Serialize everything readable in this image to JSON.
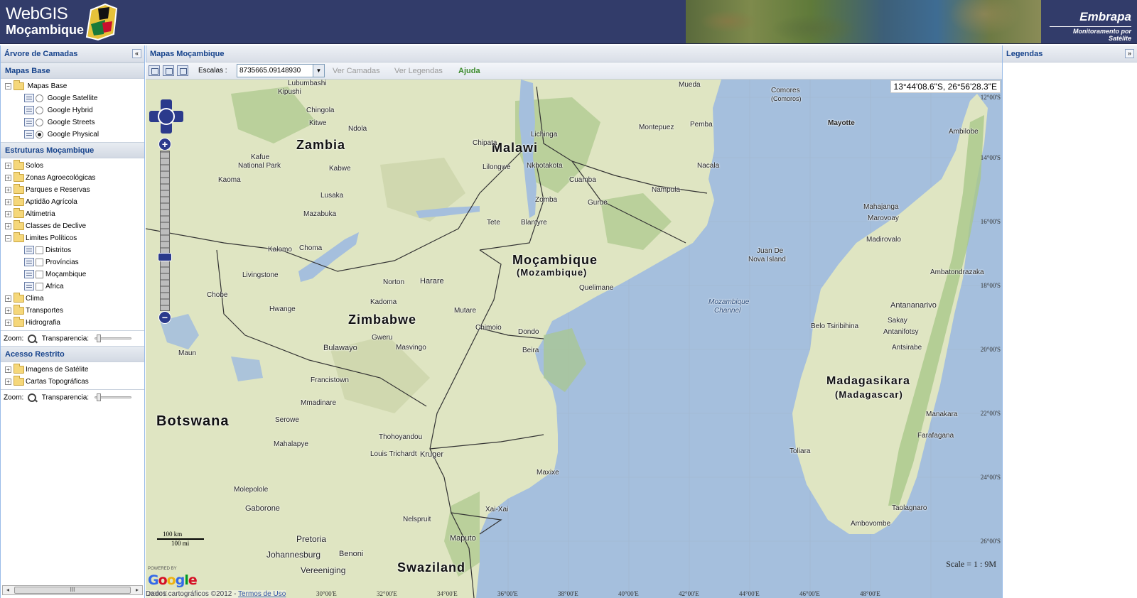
{
  "header": {
    "logo_line1": "WebGIS",
    "logo_line2": "Moçambique",
    "partner_name": "Embrapa",
    "partner_tagline": "Monitoramento por Satélite"
  },
  "left_panel": {
    "title": "Árvore de Camadas",
    "collapse_icon": "«",
    "sections": {
      "base": {
        "title": "Mapas Base",
        "folder": "Mapas Base",
        "layers": [
          "Google Satellite",
          "Google Hybrid",
          "Google Streets",
          "Google Physical"
        ],
        "selected": "Google Physical"
      },
      "estruturas": {
        "title": "Estruturas Moçambique",
        "folders": [
          "Solos",
          "Zonas Agroecológicas",
          "Parques e Reservas",
          "Aptidão Agrícola",
          "Altimetria",
          "Classes de Declive",
          "Limites Políticos"
        ],
        "limites_children": [
          "Distritos",
          "Províncias",
          "Moçambique",
          "Africa"
        ],
        "folders_after": [
          "Clima",
          "Transportes",
          "Hidrografia"
        ]
      },
      "acesso": {
        "title": "Acesso Restrito",
        "folders": [
          "Imagens de Satélite",
          "Cartas Topográficas"
        ]
      }
    },
    "zoom_label": "Zoom:",
    "transparency_label": "Transparencia:",
    "scroll_thumb": "III"
  },
  "center_panel": {
    "title": "Mapas Moçambique",
    "toolbar": {
      "scale_label": "Escalas :",
      "scale_value": "8735665.09148930",
      "ver_camadas": "Ver Camadas",
      "ver_legendas": "Ver Legendas",
      "ajuda": "Ajuda"
    },
    "map": {
      "coordinates": "13°44'08.6\"S, 26°56'28.3\"E",
      "scale_text": "Scale = 1 : 9M",
      "scalebar_km": "100 km",
      "scalebar_mi": "100 mi",
      "powered_by": "POWERED BY",
      "google": "Google",
      "attribution": "Dados cartográficos ©2012",
      "terms": "Termos de Uso",
      "countries": {
        "zambia": "Zambia",
        "malawi": "Malawi",
        "mocambique": "Moçambique",
        "mozambique": "(Mozambique)",
        "zimbabwe": "Zimbabwe",
        "botswana": "Botswana",
        "madagasikara": "Madagasikara",
        "madagascar": "(Madagascar)",
        "swaziland": "Swaziland"
      },
      "water_labels": [
        "Mozambique",
        "Channel"
      ],
      "islands": [
        "Comores",
        "(Comoros)",
        "Mayotte",
        "Juan De",
        "Nova Island"
      ],
      "cities": [
        "Lubumbashi",
        "Kipushi",
        "Chingola",
        "Kitwe",
        "Ndola",
        "Kafue",
        "National Park",
        "Kabwe",
        "Kaoma",
        "Lusaka",
        "Mazabuka",
        "Kalomo",
        "Choma",
        "Livingstone",
        "Chobe",
        "Hwange",
        "Bulawayo",
        "Gweru",
        "Masvingo",
        "Kadoma",
        "Norton",
        "Harare",
        "Mutare",
        "Chimoio",
        "Beira",
        "Dondo",
        "Tete",
        "Blantyre",
        "Zomba",
        "Lilongwe",
        "Nkhotakota",
        "Chipata",
        "Lichinga",
        "Cuamba",
        "Nampula",
        "Pemba",
        "Montepuez",
        "Nacala",
        "Quelimane",
        "Gurue",
        "Maxixe",
        "Xai-Xai",
        "Maputo",
        "Pretoria",
        "Johannesburg",
        "Benoni",
        "Gaborone",
        "Molepolole",
        "Mahalapye",
        "Serowe",
        "Francistown",
        "Mmadinare",
        "Maun",
        "Kruger",
        "Louis Trichardt",
        "Thohoyandou",
        "Nelspruit",
        "Vereeniging",
        "Mahajanga",
        "Marovoay",
        "Madirovalo",
        "Ambatondrazaka",
        "Antananarivo",
        "Antsirabe",
        "Belo Tsiribihina",
        "Sakay",
        "Antanifotsy",
        "Manakara",
        "Farafagana",
        "Toliara",
        "Taolagnaro",
        "Ambovombe",
        "Ambilobe",
        "Mueda"
      ],
      "lat_labels": [
        "12°00'S",
        "14°00'S",
        "16°00'S",
        "18°00'S",
        "20°00'S",
        "22°00'S",
        "24°00'S",
        "26°00'S"
      ],
      "lon_labels": [
        "28°00'E",
        "30°00'E",
        "32°00'E",
        "34°00'E",
        "36°00'E",
        "38°00'E",
        "40°00'E",
        "42°00'E",
        "44°00'E",
        "46°00'E",
        "48°00'E"
      ]
    }
  },
  "right_panel": {
    "title": "Legendas",
    "collapse_icon": "»"
  },
  "colors": {
    "header_bg": "#323c6a",
    "land": "#dfe5c2",
    "forest": "#a9c88a",
    "water": "#a5bfdd",
    "zoom_control": "#2b3a8c"
  }
}
